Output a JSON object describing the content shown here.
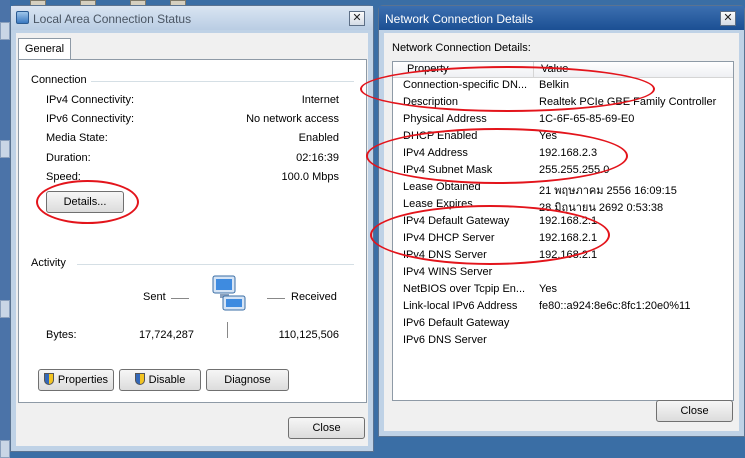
{
  "status_window": {
    "title": "Local Area Connection Status",
    "close_glyph": "✕",
    "tabs": [
      {
        "label": "General"
      }
    ],
    "connection": {
      "heading": "Connection",
      "rows": [
        {
          "label": "IPv4 Connectivity:",
          "value": "Internet"
        },
        {
          "label": "IPv6 Connectivity:",
          "value": "No network access"
        },
        {
          "label": "Media State:",
          "value": "Enabled"
        },
        {
          "label": "Duration:",
          "value": "02:16:39"
        },
        {
          "label": "Speed:",
          "value": "100.0 Mbps"
        }
      ],
      "details_button": "Details..."
    },
    "activity": {
      "heading": "Activity",
      "sent_label": "Sent",
      "received_label": "Received",
      "bytes_label": "Bytes:",
      "bytes_sent": "17,724,287",
      "bytes_received": "110,125,506"
    },
    "buttons": {
      "properties": "Properties",
      "disable": "Disable",
      "diagnose": "Diagnose",
      "close": "Close"
    }
  },
  "details_window": {
    "title": "Network Connection Details",
    "close_glyph": "✕",
    "section_label": "Network Connection Details:",
    "columns": [
      "Property",
      "Value"
    ],
    "rows": [
      {
        "property": "Connection-specific DN...",
        "value": "Belkin"
      },
      {
        "property": "Description",
        "value": "Realtek PCIe GBE Family Controller"
      },
      {
        "property": "Physical Address",
        "value": "1C-6F-65-85-69-E0"
      },
      {
        "property": "DHCP Enabled",
        "value": "Yes"
      },
      {
        "property": "IPv4 Address",
        "value": "192.168.2.3"
      },
      {
        "property": "IPv4 Subnet Mask",
        "value": "255.255.255.0"
      },
      {
        "property": "Lease Obtained",
        "value": "21 พฤษภาคม 2556 16:09:15"
      },
      {
        "property": "Lease Expires",
        "value": "28 มิถุนายน 2692 0:53:38"
      },
      {
        "property": "IPv4 Default Gateway",
        "value": "192.168.2.1"
      },
      {
        "property": "IPv4 DHCP Server",
        "value": "192.168.2.1"
      },
      {
        "property": "IPv4 DNS Server",
        "value": "192.168.2.1"
      },
      {
        "property": "IPv4 WINS Server",
        "value": ""
      },
      {
        "property": "NetBIOS over Tcpip En...",
        "value": "Yes"
      },
      {
        "property": "Link-local IPv6 Address",
        "value": "fe80::a924:8e6c:8fc1:20e0%11"
      },
      {
        "property": "IPv6 Default Gateway",
        "value": ""
      },
      {
        "property": "IPv6 DNS Server",
        "value": ""
      }
    ],
    "close_button": "Close"
  },
  "colors": {
    "annotation": "#e3141b",
    "title_active": "#1b4f93"
  }
}
